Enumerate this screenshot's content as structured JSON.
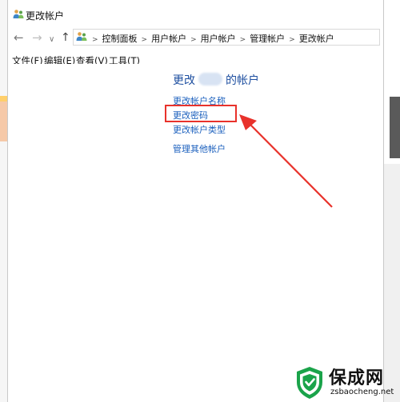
{
  "window": {
    "title": "更改帐户"
  },
  "breadcrumb": [
    "控制面板",
    "用户帐户",
    "用户帐户",
    "管理帐户",
    "更改帐户"
  ],
  "menu": [
    "文件(F)",
    "编辑(E)",
    "查看(V)",
    "工具(T)"
  ],
  "main": {
    "heading_prefix": "更改",
    "heading_suffix": "的帐户",
    "links": {
      "change_name": "更改帐户名称",
      "change_password": "更改密码",
      "change_type": "更改帐户类型",
      "manage_other": "管理其他帐户"
    }
  },
  "watermark": {
    "name": "保成网",
    "url": "zsbaocheng.net"
  },
  "colors": {
    "link": "#1a5fbd",
    "heading": "#1e4fa0",
    "highlight": "#e8322b",
    "watermark_green": "#1aa34a"
  }
}
